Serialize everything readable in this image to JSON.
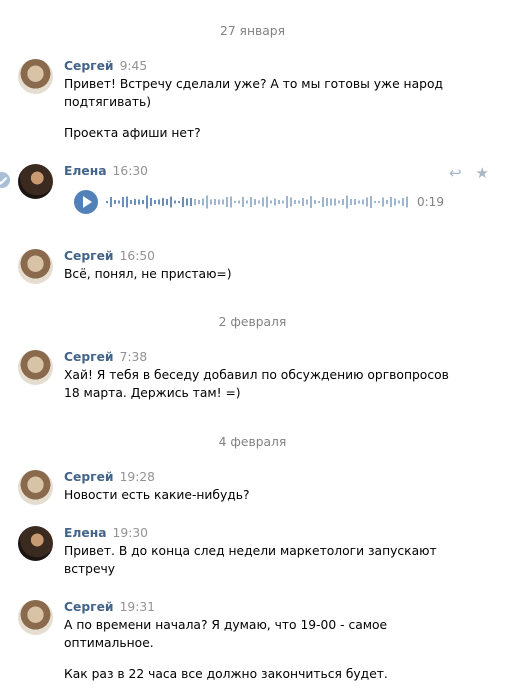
{
  "dates": [
    "27 января",
    "2 февраля",
    "4 февраля"
  ],
  "messages": [
    {
      "author": "Сергей",
      "time": "9:45",
      "lines": [
        "Привет! Встречу сделали уже? А то мы готовы уже народ подтягивать)",
        "Проекта афиши нет?"
      ]
    },
    {
      "author": "Елена",
      "time": "16:30",
      "audio_duration": "0:19"
    },
    {
      "author": "Сергей",
      "time": "16:50",
      "lines": [
        "Всё, понял, не пристаю=)"
      ]
    },
    {
      "author": "Сергей",
      "time": "7:38",
      "lines": [
        "Хай! Я тебя в беседу добавил по обсуждению оргвопросов 18 марта. Держись там! =)"
      ]
    },
    {
      "author": "Сергей",
      "time": "19:28",
      "lines": [
        "Новости есть какие-нибудь?"
      ]
    },
    {
      "author": "Елена",
      "time": "19:30",
      "lines": [
        "Привет. В до конца след недели маркетологи запускают встречу"
      ]
    },
    {
      "author": "Сергей",
      "time": "19:31",
      "lines": [
        "А по времени начала? Я думаю, что 19-00 - самое оптимальное.",
        "Как раз в 22 часа все должно закончиться будет."
      ]
    }
  ],
  "icons": {
    "reply": "reply-icon",
    "star": "star-icon",
    "read": "check-icon",
    "play": "play-icon"
  },
  "colors": {
    "author": "#42648b",
    "time": "#939393",
    "accent": "#5181b8"
  }
}
